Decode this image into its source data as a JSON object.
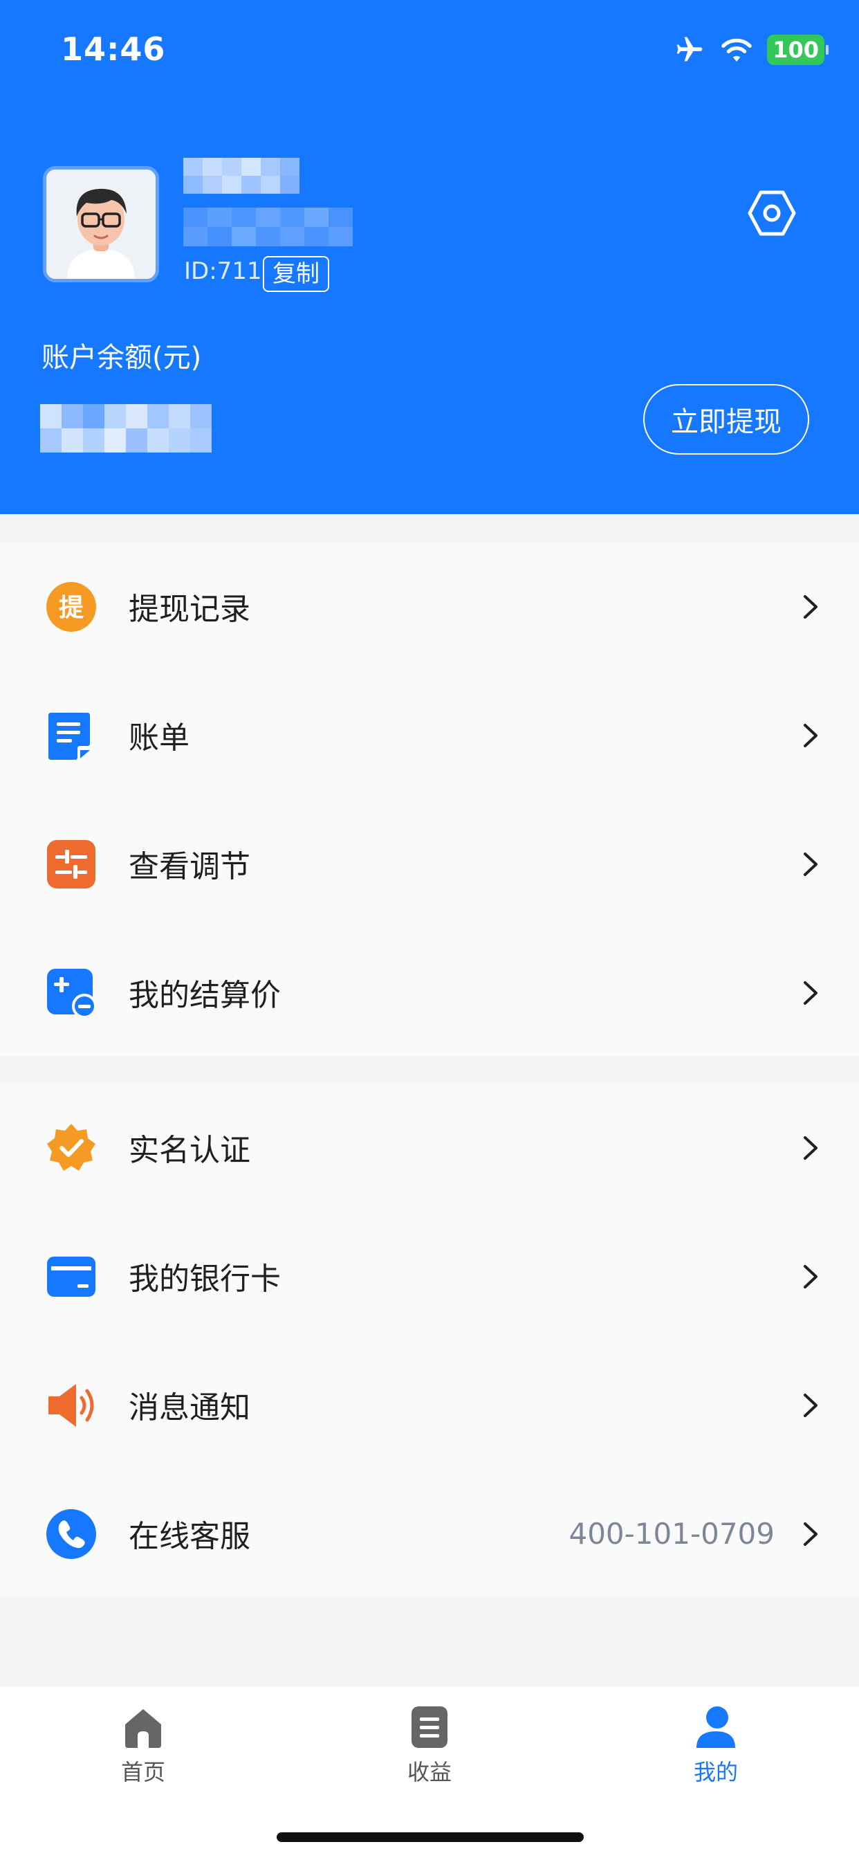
{
  "status_bar": {
    "time": "14:46",
    "battery": "100",
    "icons": [
      "airplane-icon",
      "wifi-icon",
      "battery-icon"
    ]
  },
  "profile": {
    "id_text": "ID:711",
    "copy_label": "复制",
    "settings_icon": "settings-hexagon-icon"
  },
  "account": {
    "balance_label": "账户余额(元)",
    "withdraw_label": "立即提现"
  },
  "group1": [
    {
      "label": "提现记录",
      "icon": "withdraw-record-icon",
      "color": "#f59a23"
    },
    {
      "label": "账单",
      "icon": "bill-icon",
      "color": "#1677ff"
    },
    {
      "label": "查看调节",
      "icon": "adjust-icon",
      "color": "#ee6a2f"
    },
    {
      "label": "我的结算价",
      "icon": "settlement-price-icon",
      "color": "#1677ff"
    }
  ],
  "group2": [
    {
      "label": "实名认证",
      "icon": "verified-badge-icon",
      "color": "#f59a23"
    },
    {
      "label": "我的银行卡",
      "icon": "bank-card-icon",
      "color": "#1677ff"
    },
    {
      "label": "消息通知",
      "icon": "speaker-icon",
      "color": "#ee6a2f"
    },
    {
      "label": "在线客服",
      "icon": "phone-icon",
      "color": "#1677ff",
      "extra": "400-101-0709"
    }
  ],
  "withdraw_badge_char": "提",
  "tabbar": [
    {
      "label": "首页",
      "icon": "home-icon"
    },
    {
      "label": "收益",
      "icon": "earnings-icon"
    },
    {
      "label": "我的",
      "icon": "profile-icon",
      "active": true
    }
  ],
  "colors": {
    "brand": "#1677ff",
    "orange": "#f59a23",
    "red_orange": "#ee6a2f",
    "battery_green": "#34c759"
  }
}
